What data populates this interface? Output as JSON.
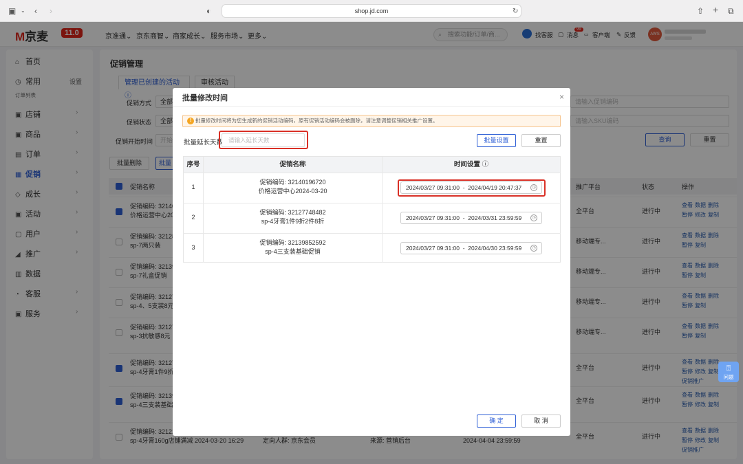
{
  "browser": {
    "url": "shop.jd.com"
  },
  "header": {
    "logo_mark": "M",
    "logo_text": "京麦",
    "version": "11.0",
    "nav": [
      "京准通",
      "京东商智",
      "商家成长",
      "服务市场",
      "更多"
    ],
    "search_placeholder": "搜索功能/订单/商...",
    "tools": {
      "kefu": "找客服",
      "messages": "消息",
      "messages_badge": "99",
      "customer": "客户端",
      "feedback": "反馈"
    },
    "avatar": "AWS"
  },
  "sidebar": {
    "home": "首页",
    "common": "常用",
    "settings": "设置",
    "order_list": "订单列表",
    "items": [
      "店铺",
      "商品",
      "订单",
      "促销",
      "成长",
      "活动",
      "用户",
      "推广",
      "数据",
      "客服",
      "服务"
    ]
  },
  "page": {
    "title": "促销管理",
    "tabs": [
      "管理已创建的活动",
      "审核活动"
    ],
    "filters": {
      "method_label": "促销方式",
      "method_value": "全部",
      "status_label": "促销状态",
      "status_value": "全部",
      "start_label": "促销开始时间",
      "start_value": "开始",
      "coupon_placeholder": "请输入促销编码",
      "sku_placeholder": "请输入SKU编码"
    },
    "buttons": {
      "batch_delete": "批量删除",
      "batch": "批量",
      "query": "查询",
      "reset": "重置"
    },
    "columns": {
      "name": "促销名称",
      "platform": "推广平台",
      "status": "状态",
      "actions": "操作"
    },
    "rows": [
      {
        "code": "促销编码: 32140",
        "name": "价格运营中心202",
        "platform": "全平台",
        "status": "进行中",
        "checked": true,
        "actions": [
          "查看",
          "数据",
          "删除",
          "暂停",
          "修改",
          "复制"
        ]
      },
      {
        "code": "促销编码: 32128",
        "name": "sp-7两只装",
        "platform": "移动端专...",
        "status": "进行中",
        "checked": false,
        "actions": [
          "查看",
          "数据",
          "删除",
          "暂停",
          "复制"
        ]
      },
      {
        "code": "促销编码: 32139",
        "name": "sp-7礼盒促销",
        "platform": "移动端专...",
        "status": "进行中",
        "checked": false,
        "actions": [
          "查看",
          "数据",
          "删除",
          "暂停",
          "复制"
        ]
      },
      {
        "code": "促销编码: 32127",
        "name": "sp-4、5支装8元",
        "platform": "移动端专...",
        "status": "进行中",
        "checked": false,
        "actions": [
          "查看",
          "数据",
          "删除",
          "暂停",
          "复制"
        ]
      },
      {
        "code": "促销编码: 32127",
        "name": "sp-3抗敏感8元",
        "platform": "移动端专...",
        "status": "进行中",
        "checked": false,
        "actions": [
          "查看",
          "数据",
          "删除",
          "暂停",
          "复制"
        ]
      },
      {
        "code": "促销编码: 32127",
        "name": "sp-4牙膏1件9折",
        "platform": "全平台",
        "status": "进行中",
        "checked": true,
        "actions": [
          "查看",
          "数据",
          "删除",
          "暂停",
          "修改",
          "复制",
          "促销推广"
        ]
      },
      {
        "code": "促销编码: 32139",
        "name": "sp-4三支装基础",
        "platform": "全平台",
        "status": "进行中",
        "checked": true,
        "actions": [
          "查看",
          "数据",
          "删除",
          "暂停",
          "修改",
          "复制"
        ]
      },
      {
        "code": "促销编码: 32122",
        "name": "sp-4牙膏160g店铺满减 2024-03-20 16:29",
        "target": "定向人群: 京东会员",
        "source": "来源: 营销后台",
        "end": "2024-04-04 23:59:59",
        "platform": "全平台",
        "status": "进行中",
        "checked": false,
        "actions": [
          "查看",
          "数据",
          "删除",
          "暂停",
          "修改",
          "复制",
          "促销推广"
        ]
      }
    ]
  },
  "modal": {
    "title": "批量修改时间",
    "close": "×",
    "warning": "批量修改时间将为您生成新的促销活动编码，原有促销活动编码会被删除，请注意调整促销相关推广设置。",
    "extend_label": "批量延长天数",
    "extend_placeholder": "请输入延长天数",
    "batch_set": "批量设置",
    "reset": "重置",
    "columns": {
      "index": "序号",
      "name": "促销名称",
      "time": "时间设置"
    },
    "rows": [
      {
        "index": "1",
        "code": "促销编码: 32140196720",
        "name": "价格运营中心2024-03-20",
        "start": "2024/03/27 09:31:00",
        "end": "2024/04/19 20:47:37"
      },
      {
        "index": "2",
        "code": "促销编码: 32127748482",
        "name": "sp-4牙膏1件9折2件8折",
        "start": "2024/03/27 09:31:00",
        "end": "2024/03/31 23:59:59"
      },
      {
        "index": "3",
        "code": "促销编码: 32139852592",
        "name": "sp-4三支装基础促销",
        "start": "2024/03/27 09:31:00",
        "end": "2024/04/30 23:59:59"
      }
    ],
    "confirm": "确 定",
    "cancel": "取 消"
  },
  "help": {
    "label": "问题"
  }
}
